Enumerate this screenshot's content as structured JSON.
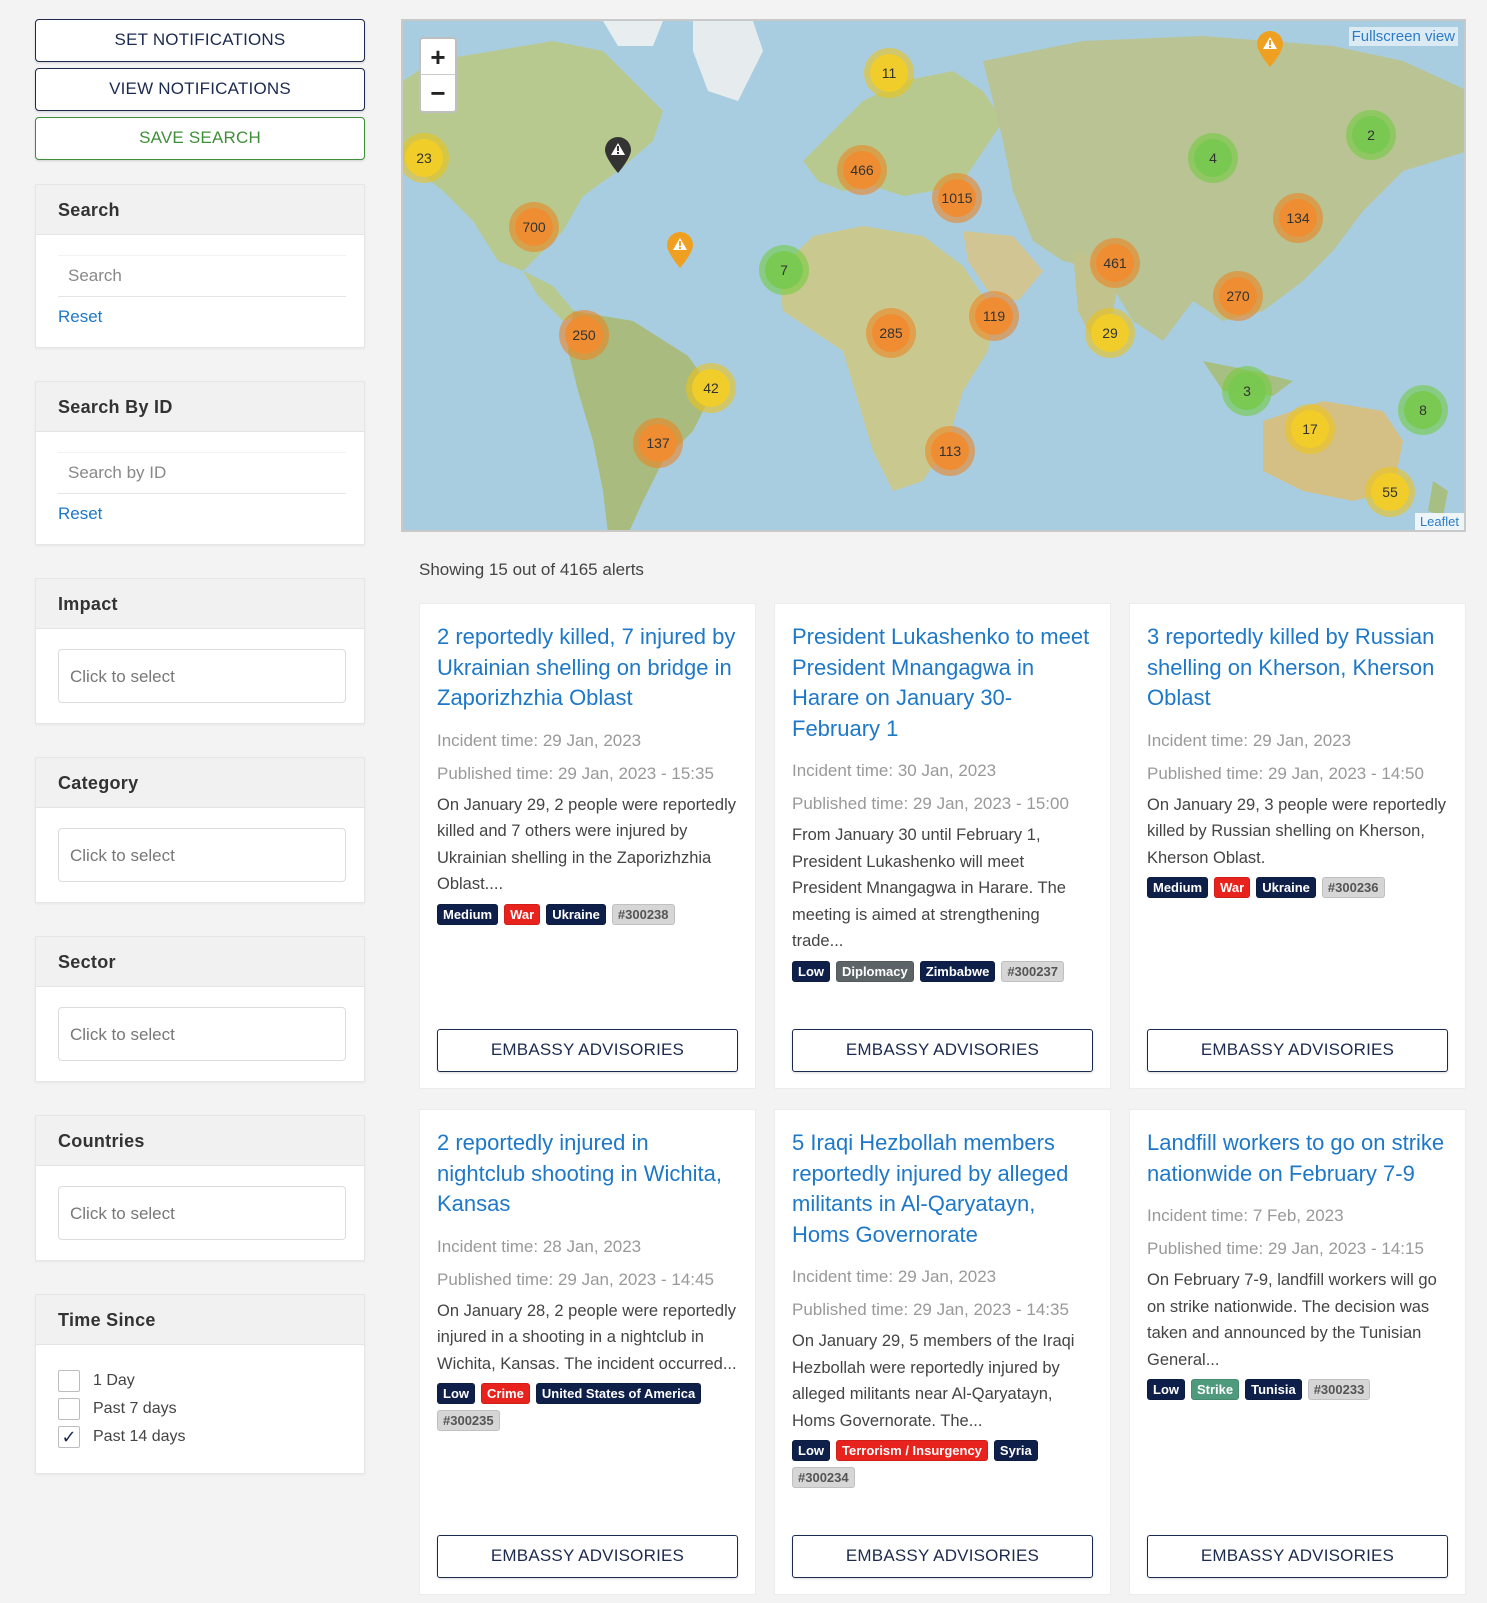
{
  "sidebar": {
    "set_notifications": "SET NOTIFICATIONS",
    "view_notifications": "VIEW NOTIFICATIONS",
    "save_search": "SAVE SEARCH",
    "search": {
      "title": "Search",
      "placeholder": "Search",
      "reset": "Reset"
    },
    "search_by_id": {
      "title": "Search By ID",
      "placeholder": "Search by ID",
      "reset": "Reset"
    },
    "impact": {
      "title": "Impact",
      "placeholder": "Click to select"
    },
    "category": {
      "title": "Category",
      "placeholder": "Click to select"
    },
    "sector": {
      "title": "Sector",
      "placeholder": "Click to select"
    },
    "countries": {
      "title": "Countries",
      "placeholder": "Click to select"
    },
    "time_since": {
      "title": "Time Since",
      "options": [
        {
          "label": "1 Day",
          "checked": false
        },
        {
          "label": "Past 7 days",
          "checked": false
        },
        {
          "label": "Past 14 days",
          "checked": true
        }
      ]
    }
  },
  "map": {
    "fullscreen": "Fullscreen view",
    "attribution": "Leaflet",
    "zoom_in": "+",
    "zoom_out": "−",
    "clusters": [
      "11",
      "23",
      "700",
      "466",
      "1015",
      "7",
      "250",
      "285",
      "119",
      "461",
      "29",
      "42",
      "137",
      "113",
      "4",
      "2",
      "134",
      "270",
      "3",
      "17",
      "8",
      "55"
    ],
    "colors": {
      "water": "#a9cde0",
      "land": "#b7c98f",
      "orange": "#f08c32",
      "yellow": "#f2cd28",
      "green": "#78c850"
    }
  },
  "results": {
    "count_text": "Showing 15 out of 4165 alerts",
    "cards": [
      {
        "title": "2 reportedly killed, 7 injured by Ukrainian shelling on bridge in Zaporizhzhia Oblast",
        "incident": "Incident time: 29 Jan, 2023",
        "published": "Published time: 29 Jan, 2023 - 15:35",
        "description": "On January 29, 2 people were reportedly killed and 7 others were injured by Ukrainian shelling in the Zaporizhzhia Oblast....",
        "tags": [
          {
            "label": "Medium",
            "type": "navy"
          },
          {
            "label": "War",
            "type": "red"
          },
          {
            "label": "Ukraine",
            "type": "navy"
          },
          {
            "label": "#300238",
            "type": "id"
          }
        ],
        "button": "EMBASSY ADVISORIES"
      },
      {
        "title": "President Lukashenko to meet President Mnangagwa in Harare on January 30-February 1",
        "incident": "Incident time: 30 Jan, 2023",
        "published": "Published time: 29 Jan, 2023 - 15:00",
        "description": "From January 30 until February 1, President Lukashenko will meet President Mnangagwa in Harare. The meeting is aimed at strengthening trade...",
        "tags": [
          {
            "label": "Low",
            "type": "navy"
          },
          {
            "label": "Diplomacy",
            "type": "gray"
          },
          {
            "label": "Zimbabwe",
            "type": "navy"
          },
          {
            "label": "#300237",
            "type": "id"
          }
        ],
        "button": "EMBASSY ADVISORIES"
      },
      {
        "title": "3 reportedly killed by Russian shelling on Kherson, Kherson Oblast",
        "incident": "Incident time: 29 Jan, 2023",
        "published": "Published time: 29 Jan, 2023 - 14:50",
        "description": "On January 29, 3 people were reportedly killed by Russian shelling on Kherson, Kherson Oblast.",
        "tags": [
          {
            "label": "Medium",
            "type": "navy"
          },
          {
            "label": "War",
            "type": "red"
          },
          {
            "label": "Ukraine",
            "type": "navy"
          },
          {
            "label": "#300236",
            "type": "id"
          }
        ],
        "button": "EMBASSY ADVISORIES"
      },
      {
        "title": "2 reportedly injured in nightclub shooting in Wichita, Kansas",
        "incident": "Incident time: 28 Jan, 2023",
        "published": "Published time: 29 Jan, 2023 - 14:45",
        "description": "On January 28, 2 people were reportedly injured in a shooting in a nightclub in Wichita, Kansas. The incident occurred...",
        "tags": [
          {
            "label": "Low",
            "type": "navy"
          },
          {
            "label": "Crime",
            "type": "red"
          },
          {
            "label": "United States of America",
            "type": "navy"
          },
          {
            "label": "#300235",
            "type": "id"
          }
        ],
        "button": "EMBASSY ADVISORIES"
      },
      {
        "title": "5 Iraqi Hezbollah members reportedly injured by alleged militants in Al-Qaryatayn, Homs Governorate",
        "incident": "Incident time: 29 Jan, 2023",
        "published": "Published time: 29 Jan, 2023 - 14:35",
        "description": "On January 29, 5 members of the Iraqi Hezbollah were reportedly injured by alleged militants near Al-Qaryatayn, Homs Governorate. The...",
        "tags": [
          {
            "label": "Low",
            "type": "navy"
          },
          {
            "label": "Terrorism / Insurgency",
            "type": "red"
          },
          {
            "label": "Syria",
            "type": "navy"
          },
          {
            "label": "#300234",
            "type": "id"
          }
        ],
        "button": "EMBASSY ADVISORIES"
      },
      {
        "title": "Landfill workers to go on strike nationwide on February 7-9",
        "incident": "Incident time: 7 Feb, 2023",
        "published": "Published time: 29 Jan, 2023 - 14:15",
        "description": "On February 7-9, landfill workers will go on strike nationwide. The decision was taken and announced by the Tunisian General...",
        "tags": [
          {
            "label": "Low",
            "type": "navy"
          },
          {
            "label": "Strike",
            "type": "green"
          },
          {
            "label": "Tunisia",
            "type": "navy"
          },
          {
            "label": "#300233",
            "type": "id"
          }
        ],
        "button": "EMBASSY ADVISORIES"
      }
    ]
  }
}
